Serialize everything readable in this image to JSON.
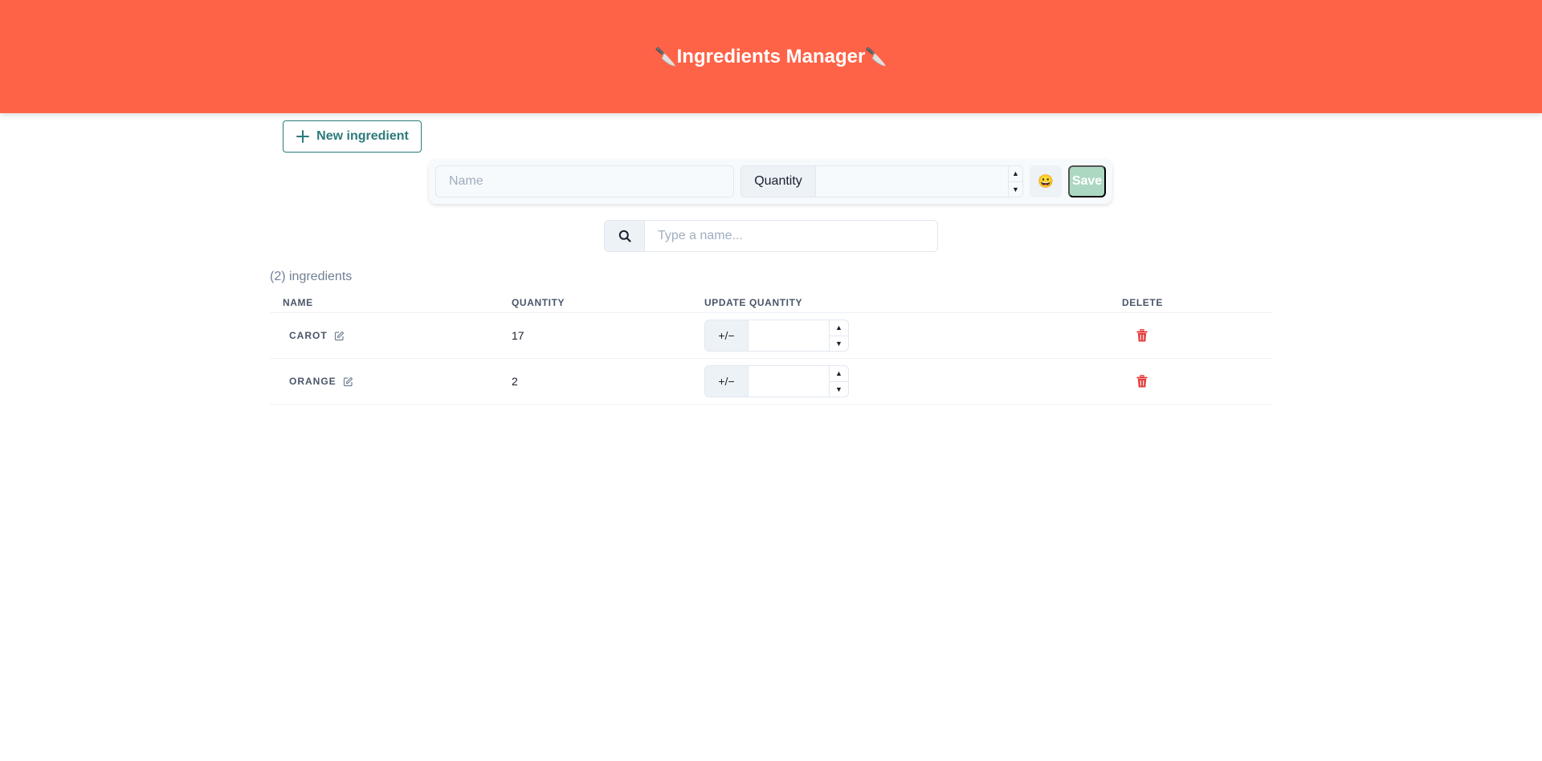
{
  "header": {
    "title": "Ingredients Manager",
    "left_icon": "🔪",
    "right_icon": "🔪",
    "background_color": "#ff6347"
  },
  "toolbar": {
    "new_ingredient_label": "New ingredient",
    "new_ingredient_icon": "plus-icon"
  },
  "form": {
    "name_placeholder": "Name",
    "name_value": "",
    "quantity_label": "Quantity",
    "quantity_value": "",
    "emoji_button": "😀",
    "save_label": "Save",
    "save_color": "#acd8c2"
  },
  "search": {
    "icon": "search-icon",
    "placeholder": "Type a name...",
    "value": ""
  },
  "list": {
    "count_text": "(2) ingredients",
    "columns": [
      "Name",
      "Quantity",
      "Update quantity",
      "Delete"
    ],
    "rows": [
      {
        "name": "Carot",
        "quantity": "17",
        "update_label": "+/−",
        "update_value": ""
      },
      {
        "name": "Orange",
        "quantity": "2",
        "update_label": "+/−",
        "update_value": ""
      }
    ],
    "delete_color": "#e53e3e"
  }
}
